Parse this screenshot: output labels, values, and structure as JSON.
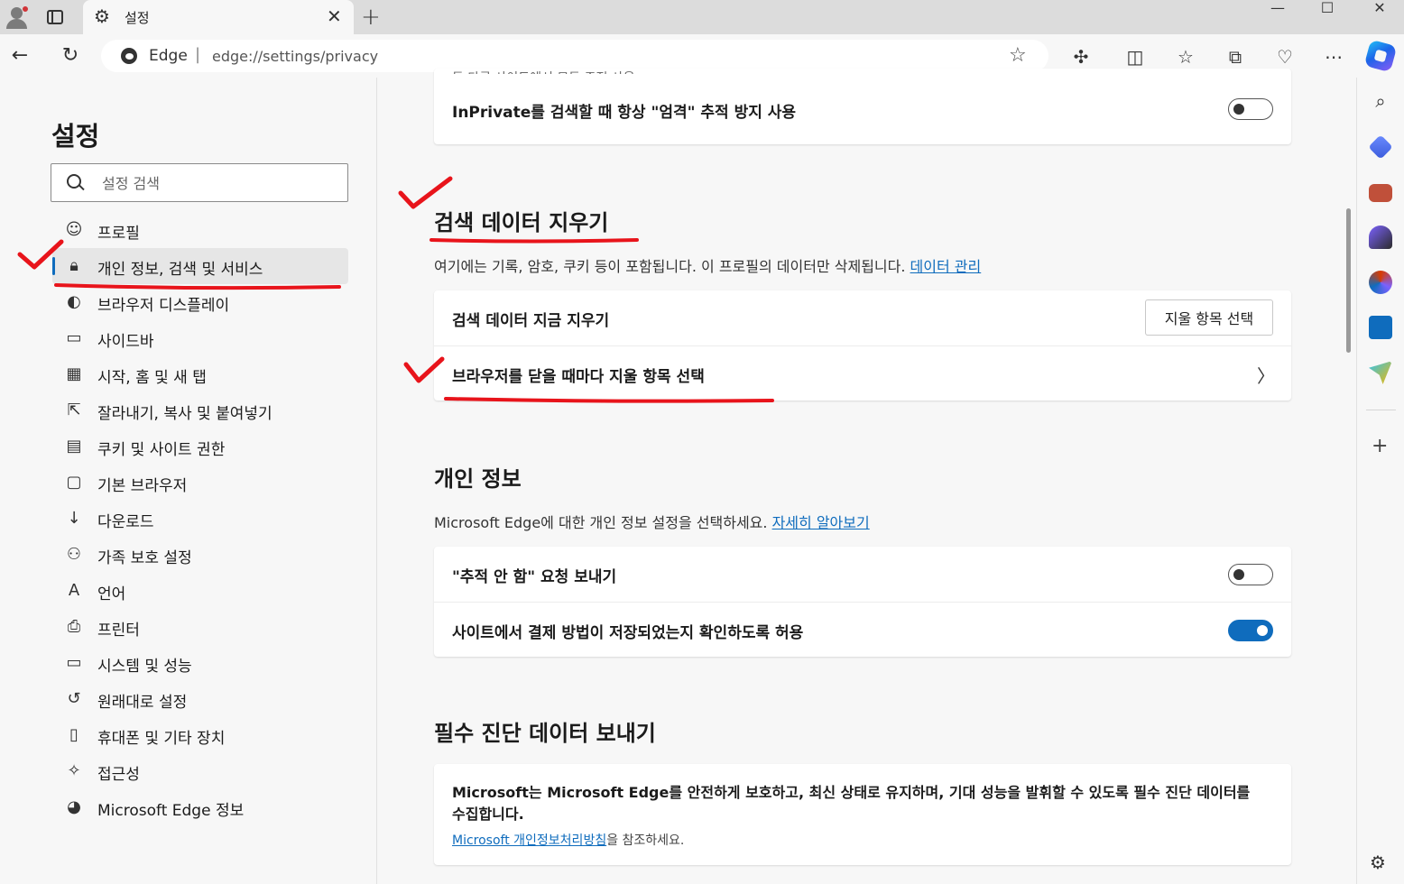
{
  "tab": {
    "title": "설정",
    "close": "✕"
  },
  "window": {
    "minimize": "—",
    "maximize": "☐",
    "close": "✕"
  },
  "address": {
    "site": "Edge",
    "separator": "|",
    "url": "edge://settings/privacy"
  },
  "sidebar": {
    "title": "설정",
    "search_placeholder": "설정 검색",
    "items": [
      {
        "label": "프로필",
        "icon": "profile-icon",
        "glyph": "☺"
      },
      {
        "label": "개인 정보, 검색 및 서비스",
        "icon": "lock-icon",
        "glyph": "🔒︎",
        "selected": true
      },
      {
        "label": "브라우저 디스플레이",
        "icon": "palette-icon",
        "glyph": "◐"
      },
      {
        "label": "사이드바",
        "icon": "sidebar-icon",
        "glyph": "▭"
      },
      {
        "label": "시작, 홈 및 새 탭",
        "icon": "home-tabs-icon",
        "glyph": "▦"
      },
      {
        "label": "잘라내기, 복사 및 붙여넣기",
        "icon": "share-icon",
        "glyph": "⇱"
      },
      {
        "label": "쿠키 및 사이트 권한",
        "icon": "cookie-permissions-icon",
        "glyph": "▤"
      },
      {
        "label": "기본 브라우저",
        "icon": "default-browser-icon",
        "glyph": "▢"
      },
      {
        "label": "다운로드",
        "icon": "download-icon",
        "glyph": "↓"
      },
      {
        "label": "가족 보호 설정",
        "icon": "family-icon",
        "glyph": "⚇"
      },
      {
        "label": "언어",
        "icon": "language-icon",
        "glyph": "A"
      },
      {
        "label": "프린터",
        "icon": "printer-icon",
        "glyph": "⎙"
      },
      {
        "label": "시스템 및 성능",
        "icon": "laptop-icon",
        "glyph": "▭"
      },
      {
        "label": "원래대로 설정",
        "icon": "reset-icon",
        "glyph": "↺"
      },
      {
        "label": "휴대폰 및 기타 장치",
        "icon": "phone-icon",
        "glyph": "▯"
      },
      {
        "label": "접근성",
        "icon": "accessibility-icon",
        "glyph": "✧"
      },
      {
        "label": "Microsoft Edge 정보",
        "icon": "edge-logo-icon",
        "glyph": "◕"
      }
    ]
  },
  "main": {
    "inprivate_card": {
      "cut_text": "든 다른 사이트에서 모든 주적 사용",
      "label": "InPrivate를 검색할 때 항상 \"엄격\" 추적 방지 사용",
      "enabled": false
    },
    "clear_data": {
      "title": "검색 데이터 지우기",
      "desc": "여기에는 기록, 암호, 쿠키 등이 포함됩니다. 이 프로필의 데이터만 삭제됩니다.",
      "desc_link": "데이터 관리",
      "row1_label": "검색 데이터 지금 지우기",
      "row1_button": "지울 항목 선택",
      "row2_label": "브라우저를 닫을 때마다 지울 항목 선택",
      "row2_chevron": "〉"
    },
    "privacy": {
      "title": "개인 정보",
      "desc": "Microsoft Edge에 대한 개인 정보 설정을 선택하세요.",
      "desc_link": "자세히 알아보기",
      "dnt_label": "\"추적 안 함\" 요청 보내기",
      "dnt_enabled": false,
      "payment_label": "사이트에서 결제 방법이 저장되었는지 확인하도록 허용",
      "payment_enabled": true
    },
    "diagnostics": {
      "title": "필수 진단 데이터 보내기",
      "text": "Microsoft는 Microsoft Edge를 안전하게 보호하고, 최신 상태로 유지하며, 기대 성능을 발휘할 수 있도록 필수 진단 데이터를 수집합니다.",
      "link": "Microsoft 개인정보처리방침",
      "link_suffix": "을 참조하세요."
    }
  },
  "colors": {
    "accent": "#0f6cbd",
    "annotation": "#e8141b"
  }
}
